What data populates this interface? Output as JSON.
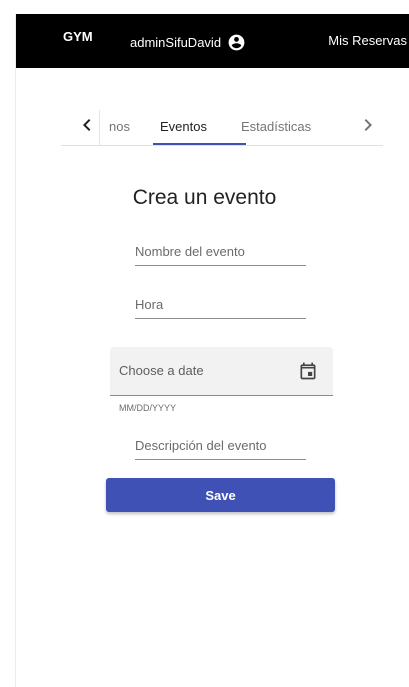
{
  "navbar": {
    "brand": "GYM",
    "username": "adminSifuDavid",
    "user_icon": "account-circle-icon",
    "reservations_link": "Mis Reservas"
  },
  "tabs": {
    "prev_icon": "chevron-left-icon",
    "next_icon": "chevron-right-icon",
    "items": [
      {
        "label": "Horarios",
        "visible_fragment": "nos",
        "active": false
      },
      {
        "label": "Eventos",
        "active": true
      },
      {
        "label": "Estadísticas",
        "active": false
      }
    ]
  },
  "form": {
    "title": "Crea un evento",
    "name_placeholder": "Nombre del evento",
    "time_placeholder": "Hora",
    "date_placeholder": "Choose a date",
    "date_hint": "MM/DD/YYYY",
    "date_icon": "calendar-icon",
    "description_placeholder": "Descripción del evento",
    "save_label": "Save"
  },
  "colors": {
    "topbar": "#000000",
    "primary": "#3f51b5",
    "date_field_bg": "#f2f2f2"
  }
}
